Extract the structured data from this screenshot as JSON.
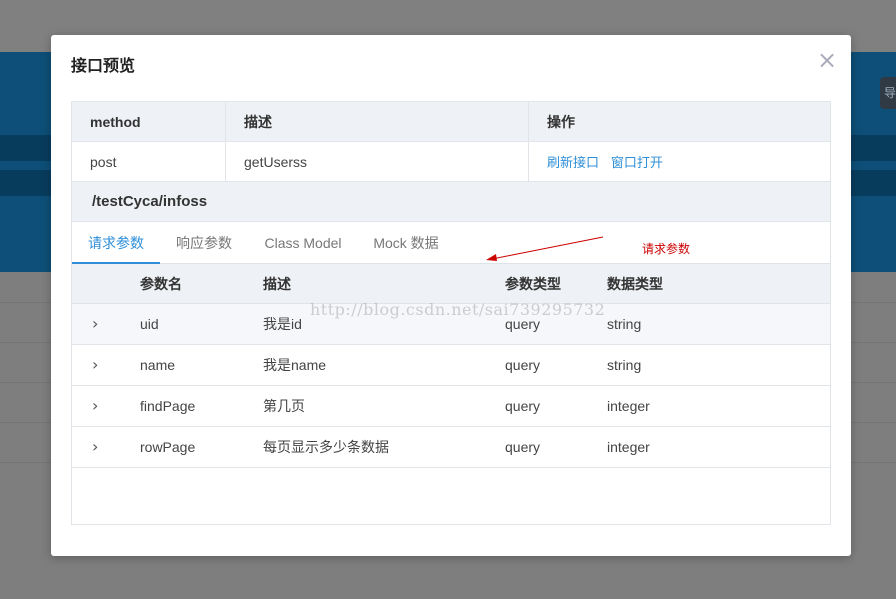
{
  "modal": {
    "title": "接口预览",
    "close_glyph": "×"
  },
  "background": {
    "side_button_label": "导"
  },
  "info_table": {
    "headers": [
      "method",
      "描述",
      "操作"
    ],
    "row": {
      "method": "post",
      "description": "getUserss",
      "actions": [
        "刷新接口",
        "窗口打开"
      ]
    }
  },
  "path": "/testCyca/infoss",
  "tabs": [
    {
      "label": "请求参数",
      "active": true
    },
    {
      "label": "响应参数",
      "active": false
    },
    {
      "label": "Class Model",
      "active": false
    },
    {
      "label": "Mock 数据",
      "active": false
    }
  ],
  "annotation": {
    "text": "请求参数",
    "color": "#cc0000"
  },
  "params": {
    "headers": [
      "参数名",
      "描述",
      "参数类型",
      "数据类型"
    ],
    "expand_glyph": "›",
    "rows": [
      {
        "name": "uid",
        "description": "我是id",
        "param_type": "query",
        "data_type": "string"
      },
      {
        "name": "name",
        "description": "我是name",
        "param_type": "query",
        "data_type": "string"
      },
      {
        "name": "findPage",
        "description": "第几页",
        "param_type": "query",
        "data_type": "integer"
      },
      {
        "name": "rowPage",
        "description": "每页显示多少条数据",
        "param_type": "query",
        "data_type": "integer"
      }
    ]
  },
  "watermark": "http://blog.csdn.net/sai739295732",
  "colors": {
    "accent": "#2f8fd8",
    "header_bg": "#eef1f5",
    "border": "#e1e5ea"
  }
}
